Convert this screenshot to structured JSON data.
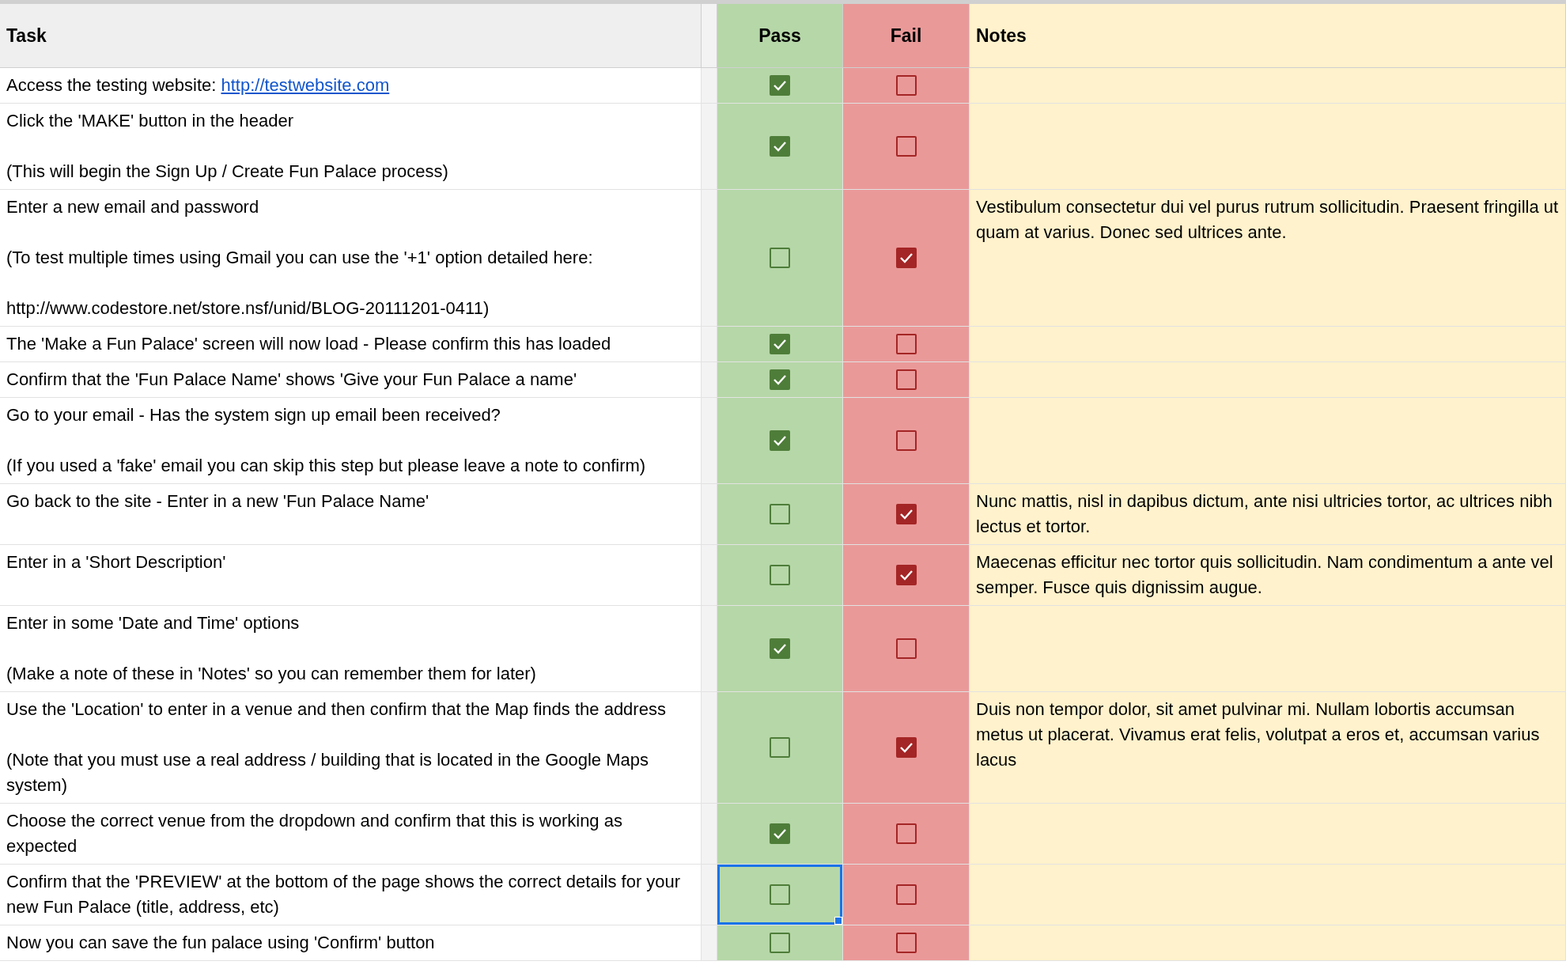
{
  "header": {
    "task": "Task",
    "pass": "Pass",
    "fail": "Fail",
    "notes": "Notes"
  },
  "rows": [
    {
      "task": "Access the testing website: ",
      "link": "http://testwebsite.com",
      "pass_checked": true,
      "fail_checked": false,
      "pass_selected": false
    },
    {
      "task": "Click the 'MAKE' button in the header\n\n(This will begin the Sign Up / Create Fun Palace process)",
      "pass_checked": true,
      "fail_checked": false,
      "pass_selected": false
    },
    {
      "task": "Enter a new email and password\n\n(To test multiple times using Gmail you can use the '+1' option detailed here:\n\nhttp://www.codestore.net/store.nsf/unid/BLOG-20111201-0411)",
      "pass_checked": false,
      "fail_checked": true,
      "pass_selected": false,
      "note": "Vestibulum consectetur dui vel purus rutrum sollicitudin. Praesent fringilla ut quam at varius. Donec sed ultrices ante."
    },
    {
      "task": "The 'Make a Fun Palace' screen will now load - Please confirm this has loaded",
      "pass_checked": true,
      "fail_checked": false,
      "pass_selected": false
    },
    {
      "task": "Confirm that the 'Fun Palace Name' shows 'Give your Fun Palace a name'",
      "pass_checked": true,
      "fail_checked": false,
      "pass_selected": false
    },
    {
      "task": "Go to your email - Has the system sign up email been received?\n\n(If you used a 'fake' email you can skip this step but please leave a note to confirm)",
      "pass_checked": true,
      "fail_checked": false,
      "pass_selected": false
    },
    {
      "task": "Go back to the site - Enter in a new 'Fun Palace Name'",
      "pass_checked": false,
      "fail_checked": true,
      "pass_selected": false,
      "note": "Nunc mattis, nisl in dapibus dictum, ante nisi ultricies tortor, ac ultrices nibh lectus et tortor."
    },
    {
      "task": "Enter in a 'Short Description'",
      "pass_checked": false,
      "fail_checked": true,
      "pass_selected": false,
      "note": "Maecenas efficitur nec tortor quis sollicitudin. Nam condimentum a ante vel semper. Fusce quis dignissim augue."
    },
    {
      "task": "Enter in some 'Date and Time' options\n\n(Make a note of these in 'Notes' so you can remember them for later)",
      "pass_checked": true,
      "fail_checked": false,
      "pass_selected": false
    },
    {
      "task": "Use the 'Location' to enter in a venue and then confirm that the Map finds the address\n\n(Note that you must use a real address / building that is located in the Google Maps system)",
      "pass_checked": false,
      "fail_checked": true,
      "pass_selected": false,
      "note": "Duis non tempor dolor, sit amet pulvinar mi. Nullam lobortis accumsan metus ut placerat. Vivamus erat felis, volutpat a eros et, accumsan varius lacus"
    },
    {
      "task": "Choose the correct venue from the dropdown and confirm that this is working as expected",
      "pass_checked": true,
      "fail_checked": false,
      "pass_selected": false
    },
    {
      "task": "Confirm that the 'PREVIEW' at the bottom of the page shows the correct details for your new Fun Palace (title, address, etc)",
      "pass_checked": false,
      "fail_checked": false,
      "pass_selected": true
    },
    {
      "task": "Now you can save the fun palace using 'Confirm' button",
      "pass_checked": false,
      "fail_checked": false,
      "pass_selected": false
    }
  ]
}
